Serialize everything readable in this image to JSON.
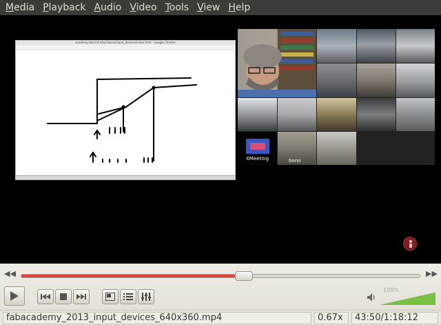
{
  "menu": [
    {
      "label": "Media",
      "mnemonic": "M",
      "rest": "edia"
    },
    {
      "label": "Playback",
      "mnemonic": "P",
      "rest": "layback"
    },
    {
      "label": "Audio",
      "mnemonic": "A",
      "rest": "udio"
    },
    {
      "label": "Video",
      "mnemonic": "V",
      "rest": "ideo"
    },
    {
      "label": "Tools",
      "mnemonic": "T",
      "rest": "ools"
    },
    {
      "label": "View",
      "mnemonic": "V",
      "rest": "iew"
    },
    {
      "label": "Help",
      "mnemonic": "H",
      "rest": "elp"
    }
  ],
  "video": {
    "screen_title": "academy.cba.mit.edu/classes/input_devices/index.html - Google Chrome",
    "xmeeting_label": "XMeeting",
    "bono_label": "bono"
  },
  "playback": {
    "progress_fraction": 0.559
  },
  "volume": {
    "percent_label": "100%",
    "level_fraction": 1.0
  },
  "status": {
    "filename": "fabacademy_2013_input_devices_640x360.mp4",
    "speed": "0.67x",
    "time": "43:50/1:18:12"
  },
  "colors": {
    "menubar": "#3c3b37",
    "seek_fill": "#e0453b",
    "volume_fill": "#7ac142"
  }
}
